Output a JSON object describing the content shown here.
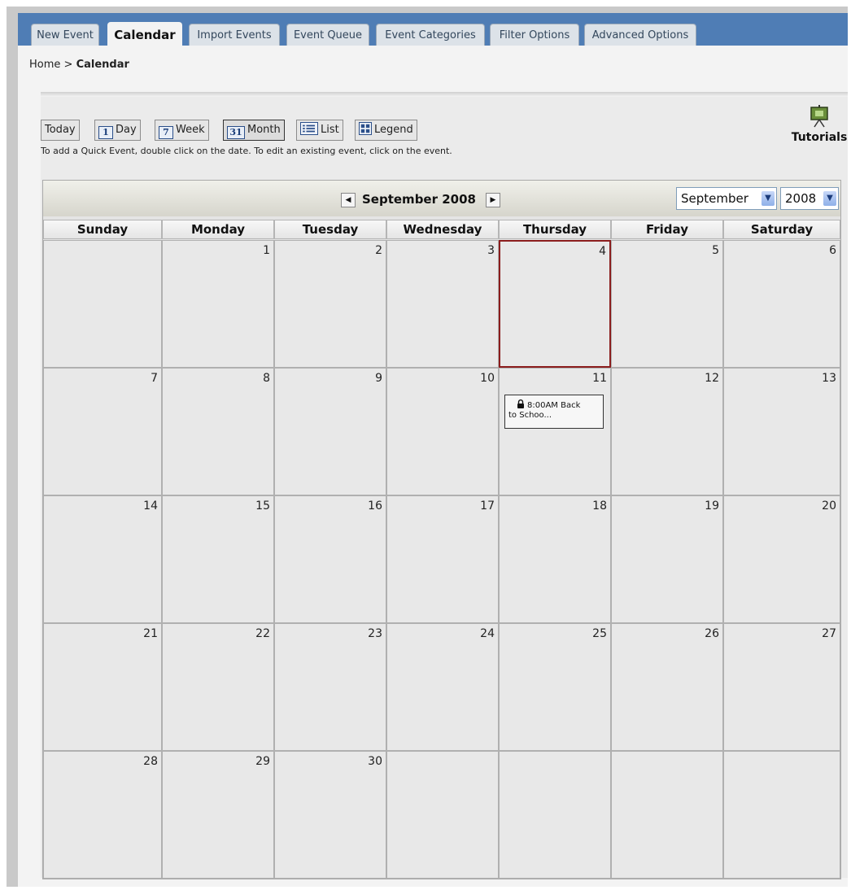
{
  "tabs": [
    {
      "label": "New Event"
    },
    {
      "label": "Calendar"
    },
    {
      "label": "Import Events"
    },
    {
      "label": "Event Queue"
    },
    {
      "label": "Event Categories"
    },
    {
      "label": "Filter Options"
    },
    {
      "label": "Advanced Options"
    }
  ],
  "breadcrumb": {
    "home": "Home",
    "sep": ">",
    "current": "Calendar"
  },
  "views": {
    "today": "Today",
    "day": "Day",
    "day_icon": "1",
    "week": "Week",
    "week_icon": "7",
    "month": "Month",
    "month_icon": "31",
    "list": "List",
    "legend": "Legend"
  },
  "hint": "To add a Quick Event, double click on the date. To edit an existing event, click on the event.",
  "tutorials": {
    "label": "Tutorials",
    "icon": "presentation-board-icon"
  },
  "calendar": {
    "title": "September 2008",
    "month_select": "September",
    "year_select": "2008",
    "weekdays": [
      "Sunday",
      "Monday",
      "Tuesday",
      "Wednesday",
      "Thursday",
      "Friday",
      "Saturday"
    ],
    "weeks": [
      [
        "",
        "1",
        "2",
        "3",
        "4",
        "5",
        "6"
      ],
      [
        "7",
        "8",
        "9",
        "10",
        "11",
        "12",
        "13"
      ],
      [
        "14",
        "15",
        "16",
        "17",
        "18",
        "19",
        "20"
      ],
      [
        "21",
        "22",
        "23",
        "24",
        "25",
        "26",
        "27"
      ],
      [
        "28",
        "29",
        "30",
        "",
        "",
        "",
        ""
      ]
    ],
    "today": "4",
    "event": {
      "day": "11",
      "line1": "8:00AM Back",
      "line2": "to Schoo...",
      "icon": "lock-icon"
    }
  },
  "colors": {
    "tabbar": "#4f7db5",
    "today_border": "#8b1d1d"
  }
}
